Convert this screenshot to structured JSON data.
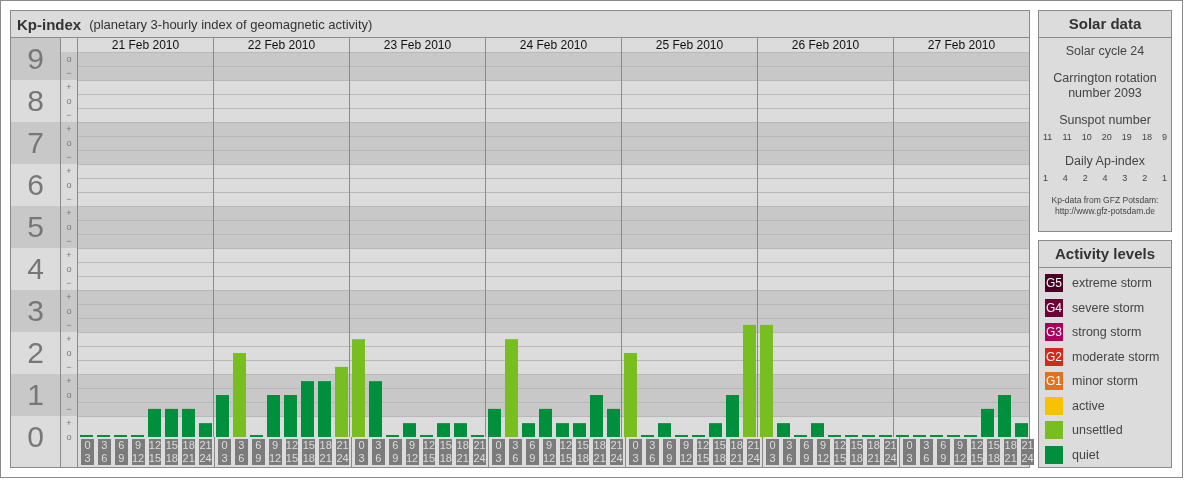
{
  "kp_index": {
    "title": "Kp-index",
    "subtitle": "(planetary 3-hourly index of geomagnetic activity)",
    "days": [
      "21 Feb 2010",
      "22 Feb 2010",
      "23 Feb 2010",
      "24 Feb 2010",
      "25 Feb 2010",
      "26 Feb 2010",
      "27 Feb 2010"
    ],
    "sub_marks": [
      "o",
      "−",
      "+",
      "o",
      "−",
      "+",
      "o",
      "−",
      "+",
      "o",
      "−",
      "+",
      "o",
      "−",
      "+",
      "o",
      "−",
      "+",
      "o",
      "−",
      "+",
      "o",
      "−",
      "+",
      "o",
      "−",
      "+",
      "o"
    ],
    "chart_data": {
      "type": "bar",
      "ylim": [
        0,
        9.17
      ],
      "yticks": [
        {
          "value": 0,
          "label": "0"
        },
        {
          "value": 1,
          "label": "1"
        },
        {
          "value": 2,
          "label": "2"
        },
        {
          "value": 3,
          "label": "3"
        },
        {
          "value": 4,
          "label": "4"
        },
        {
          "value": 5,
          "label": "5"
        },
        {
          "value": 6,
          "label": "6"
        },
        {
          "value": 7,
          "label": "7"
        },
        {
          "value": 8,
          "label": "8"
        },
        {
          "value": 9,
          "label": "9"
        }
      ],
      "categories": [
        "0 3",
        "3 6",
        "6 9",
        "9 12",
        "12 15",
        "15 18",
        "18 21",
        "21 24",
        "0 3",
        "3 6",
        "6 9",
        "9 12",
        "12 15",
        "15 18",
        "18 21",
        "21 24",
        "0 3",
        "3 6",
        "6 9",
        "9 12",
        "12 15",
        "15 18",
        "18 21",
        "21 24",
        "0 3",
        "3 6",
        "6 9",
        "9 12",
        "12 15",
        "15 18",
        "18 21",
        "21 24",
        "0 3",
        "3 6",
        "6 9",
        "9 12",
        "12 15",
        "15 18",
        "18 21",
        "21 24",
        "0 3",
        "3 6",
        "6 9",
        "9 12",
        "12 15",
        "15 18",
        "18 21",
        "21 24",
        "0 3",
        "3 6",
        "6 9",
        "9 12",
        "12 15",
        "15 18",
        "18 21",
        "21 24"
      ],
      "series": [
        {
          "color": "#008f3c",
          "values": [
            0,
            0,
            0,
            0,
            0.67,
            0.67,
            0.67,
            0.33,
            1,
            null,
            0,
            1,
            1,
            1.33,
            1.33,
            null,
            null,
            1.33,
            0,
            0.33,
            0,
            0.33,
            0.33,
            0,
            0.67,
            null,
            0.33,
            0.67,
            0.33,
            0.33,
            1,
            0.67,
            null,
            0,
            0.33,
            0,
            0,
            0.33,
            1,
            null,
            null,
            0.33,
            0,
            0.33,
            0,
            0,
            0,
            0,
            0,
            0,
            0,
            0,
            0,
            0.67,
            1,
            0.33
          ]
        },
        {
          "color": "#78be20",
          "values": [
            null,
            null,
            null,
            null,
            null,
            null,
            null,
            null,
            null,
            2,
            null,
            null,
            null,
            null,
            null,
            1.67,
            2.33,
            null,
            null,
            null,
            null,
            null,
            null,
            null,
            null,
            2.33,
            null,
            null,
            null,
            null,
            null,
            null,
            2,
            null,
            null,
            null,
            null,
            null,
            null,
            2.67,
            2.67,
            null,
            null,
            null,
            null,
            null,
            null,
            null,
            null,
            null,
            null,
            null,
            null,
            null,
            null,
            null
          ]
        }
      ]
    }
  },
  "solar_data": {
    "title": "Solar data",
    "cycle": "Solar cycle 24",
    "rotation": "Carrington rotation number 2093",
    "sunspot_label": "Sunspot number",
    "sunspot_values": [
      "11",
      "11",
      "10",
      "20",
      "19",
      "18",
      "9"
    ],
    "ap_label": "Daily Ap-index",
    "ap_values": [
      "1",
      "4",
      "2",
      "4",
      "3",
      "2",
      "1"
    ],
    "source": "Kp-data from GFZ Potsdam:",
    "url": "http://www.gfz-potsdam.de"
  },
  "activity_levels": {
    "title": "Activity levels",
    "items": [
      {
        "badge": "G5",
        "label": "extreme storm",
        "color": "#4a0022"
      },
      {
        "badge": "G4",
        "label": "severe storm",
        "color": "#6e0038"
      },
      {
        "badge": "G3",
        "label": "strong storm",
        "color": "#a8005c"
      },
      {
        "badge": "G2",
        "label": "moderate storm",
        "color": "#d2291e"
      },
      {
        "badge": "G1",
        "label": "minor storm",
        "color": "#e2711d"
      },
      {
        "label": "active",
        "color": "#f7c200"
      },
      {
        "label": "unsettled",
        "color": "#78be20"
      },
      {
        "label": "quiet",
        "color": "#008f3c"
      }
    ]
  }
}
